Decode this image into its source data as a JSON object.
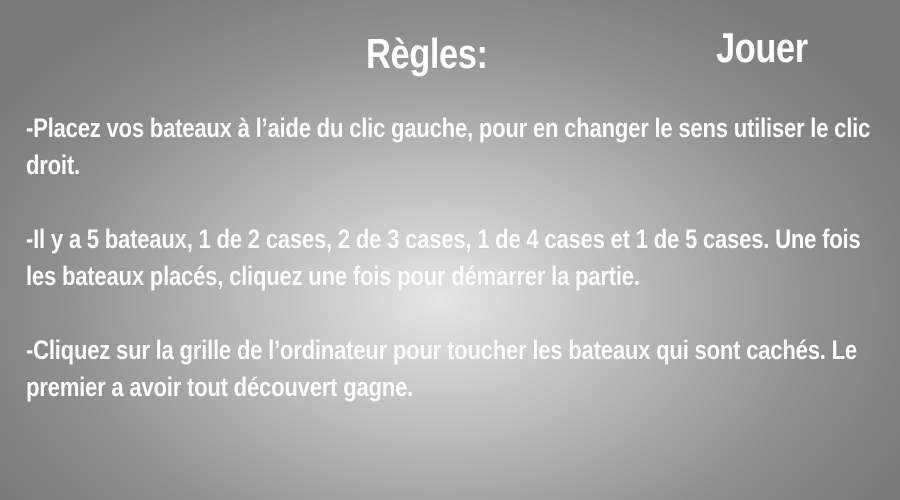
{
  "header": {
    "title": "Règles:",
    "play_label": "Jouer"
  },
  "rules": [
    "-Placez vos bateaux à l’aide du clic gauche, pour en changer le sens utiliser le clic droit.",
    "-Il y a 5 bateaux, 1 de 2 cases, 2 de 3 cases, 1 de 4 cases et 1 de 5 cases. Une fois les bateaux placés, cliquez une fois pour démarrer la partie.",
    "-Cliquez sur la grille de l’ordinateur pour toucher les bateaux qui sont cachés. Le premier a avoir tout découvert gagne."
  ],
  "colors": {
    "text": "#ffffff",
    "background_center": "#e6e6e6",
    "background_edge": "#7a7a7a"
  }
}
